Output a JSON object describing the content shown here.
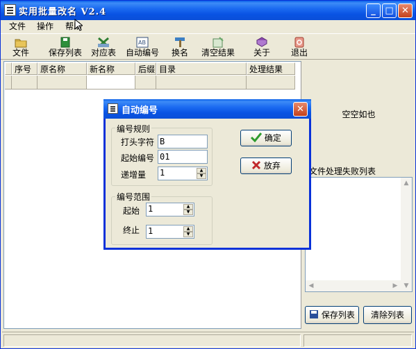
{
  "app": {
    "title": "实用批量改名 V2.4"
  },
  "window_controls": {
    "minimize": "_",
    "maximize": "□",
    "close": "✕"
  },
  "menu": [
    {
      "label": "文件"
    },
    {
      "label": "操作"
    },
    {
      "label": "帮助"
    }
  ],
  "toolbar": [
    {
      "label": "文件",
      "icon": "folder-icon"
    },
    {
      "label": "保存列表",
      "icon": "save-icon"
    },
    {
      "label": "对应表",
      "icon": "table-icon"
    },
    {
      "label": "自动编号",
      "icon": "auto-number-icon"
    },
    {
      "label": "换名",
      "icon": "rename-icon"
    },
    {
      "label": "清空结果",
      "icon": "clear-icon"
    },
    {
      "label": "关于",
      "icon": "book-icon"
    },
    {
      "label": "退出",
      "icon": "exit-icon"
    }
  ],
  "table": {
    "columns": [
      "序号",
      "原名称",
      "新名称",
      "后缀",
      "目录",
      "处理结果"
    ]
  },
  "right_panel": {
    "empty_text": "空空如也",
    "fail_list_title": "文件处理失败列表",
    "save_button": "保存列表",
    "clear_button": "清除列表"
  },
  "dialog": {
    "title": "自动编号",
    "group_rule": "编号规则",
    "prefix_label": "打头字符",
    "prefix_value": "B",
    "start_label": "起始编号",
    "start_value": "01",
    "step_label": "递增量",
    "step_value": "1",
    "group_range": "编号范围",
    "range_start_label": "起始",
    "range_start_value": "1",
    "range_end_label": "终止",
    "range_end_value": "1",
    "ok_button": "确定",
    "cancel_button": "放弃",
    "close": "✕"
  },
  "colors": {
    "title_bar": "#0a5fe8",
    "window_bg": "#ece9d8",
    "ok_check": "#2e9b2e",
    "cancel_x": "#c0282b"
  }
}
